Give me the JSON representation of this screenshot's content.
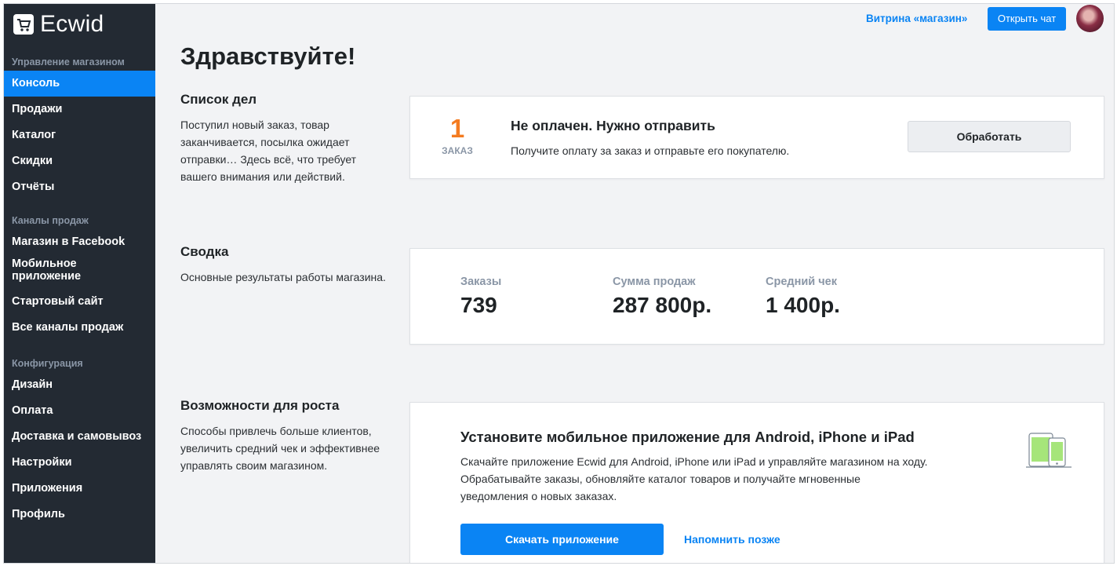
{
  "brand": {
    "name": "Ecwid"
  },
  "sidebar": {
    "sections": [
      {
        "header": "Управление магазином",
        "items": [
          {
            "label": "Консоль",
            "active": true
          },
          {
            "label": "Продажи"
          },
          {
            "label": "Каталог"
          },
          {
            "label": "Скидки"
          },
          {
            "label": "Отчёты"
          }
        ]
      },
      {
        "header": "Каналы продаж",
        "items": [
          {
            "label": "Магазин в Facebook"
          },
          {
            "label": "Мобильное приложение"
          },
          {
            "label": "Стартовый сайт"
          },
          {
            "label": "Все каналы продаж"
          }
        ]
      },
      {
        "header": "Конфигурация",
        "items": [
          {
            "label": "Дизайн"
          },
          {
            "label": "Оплата"
          },
          {
            "label": "Доставка и самовывоз"
          },
          {
            "label": "Настройки"
          },
          {
            "label": "Приложения"
          },
          {
            "label": "Профиль"
          }
        ]
      }
    ]
  },
  "topbar": {
    "storefront_link": "Витрина «магазин»",
    "chat_button": "Открыть чат"
  },
  "page": {
    "title": "Здравствуйте!"
  },
  "todo": {
    "title": "Список дел",
    "description": "Поступил новый заказ, товар заканчивается, посылка ожидает отправки… Здесь всё, что требует вашего внимания или действий.",
    "task": {
      "count": "1",
      "unit": "ЗАКАЗ",
      "title": "Не оплачен. Нужно отправить",
      "description": "Получите оплату за заказ и отправьте его покупателю.",
      "button": "Обработать"
    }
  },
  "summary": {
    "title": "Сводка",
    "description": "Основные результаты работы магазина.",
    "stats": [
      {
        "label": "Заказы",
        "value": "739"
      },
      {
        "label": "Сумма продаж",
        "value": "287 800р."
      },
      {
        "label": "Средний чек",
        "value": "1 400р."
      }
    ]
  },
  "growth": {
    "title": "Возможности для роста",
    "description": "Способы привлечь больше клиентов, увеличить средний чек и эффективнее управлять своим магазином.",
    "card": {
      "title": "Установите мобильное приложение для Android, iPhone и iPad",
      "description": "Скачайте приложение Ecwid для Android, iPhone или iPad и управляйте магазином на ходу. Обрабатывайте заказы, обновляйте каталог товаров и получайте мгновенные уведомления о новых заказах.",
      "primary_button": "Скачать приложение",
      "secondary_link": "Напомнить позже",
      "icon": "devices-icon"
    }
  },
  "colors": {
    "sidebar_bg": "#232a33",
    "accent": "#0a84f4",
    "count_orange": "#f47b20",
    "page_bg": "#f2f3f5"
  }
}
